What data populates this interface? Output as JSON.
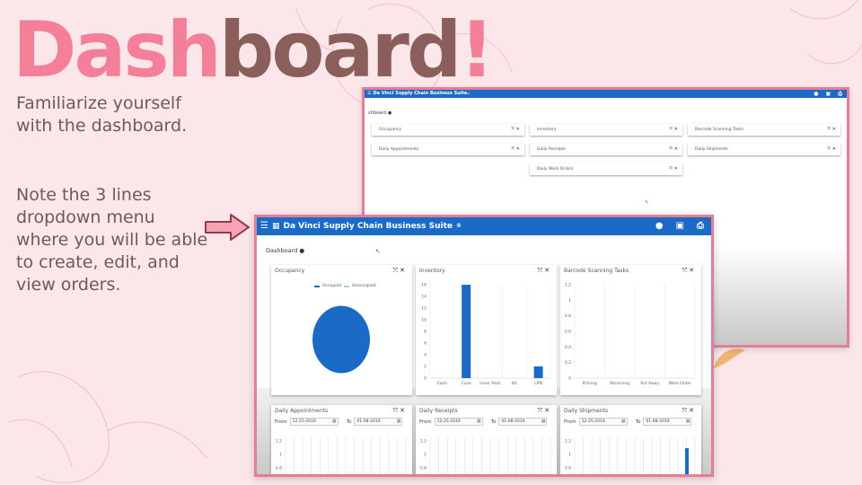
{
  "slide": {
    "title_part1": "Dash",
    "title_part2": "board",
    "title_bang": "!",
    "desc1": "Familiarize yourself with the dashboard.",
    "desc2": "Note the 3 lines dropdown menu where you will be able to create, edit, and view orders.",
    "colors": {
      "pink": "#f47f98",
      "brown": "#8a5e5a",
      "background": "#fbe7e9"
    }
  },
  "app": {
    "title": "Da Vinci Supply Chain Business Suite",
    "title_mark": "®",
    "menu_icon": "hamburger-icon",
    "header_icons": [
      "user-icon",
      "building-icon",
      "printer-icon"
    ],
    "breadcrumb": "Dashboard",
    "breadcrumb_back": "shboard",
    "accent": "#1a6bc5"
  },
  "back_window": {
    "widgets": [
      "Occupancy",
      "Inventory",
      "Barcode Scanning Tasks",
      "Daily Appointments",
      "Daily Receipts",
      "Daily Shipments",
      "Daily Work Orders"
    ]
  },
  "front_window": {
    "occupancy": {
      "title": "Occupancy",
      "legend": [
        "Occupied",
        "Unoccupied"
      ]
    },
    "inventory": {
      "title": "Inventory"
    },
    "barcode": {
      "title": "Barcode Scanning Tasks"
    },
    "daily_appointments": {
      "title": "Daily Appointments",
      "from_label": "From",
      "from": "12-25-2019",
      "to_label": "To",
      "to": "01-08-2019"
    },
    "daily_receipts": {
      "title": "Daily Receipts",
      "from_label": "From",
      "from": "12-25-2019",
      "to_label": "To",
      "to": "01-08-2019"
    },
    "daily_shipments": {
      "title": "Daily Shipments",
      "from_label": "From",
      "from": "12-25-2019",
      "to_label": "To",
      "to": "01-08-2019"
    }
  },
  "chart_data": [
    {
      "type": "pie",
      "categories": [
        "Occupied",
        "Unoccupied"
      ],
      "values": [
        100,
        0
      ],
      "colors": [
        "#1a6bc5",
        "#9ecbf0"
      ]
    },
    {
      "type": "bar",
      "categories": [
        "Each",
        "Case",
        "Inner Pack",
        "Kit",
        "LPN"
      ],
      "values": [
        0,
        16,
        0,
        0,
        2
      ],
      "yticks": [
        "0",
        "2",
        "4",
        "6",
        "8",
        "10",
        "12",
        "14",
        "16"
      ],
      "ylim": [
        0,
        16
      ]
    },
    {
      "type": "bar",
      "categories": [
        "Picking",
        "Receiving",
        "Put Away",
        "Work Order"
      ],
      "values": [
        0,
        0,
        0,
        0
      ],
      "yticks": [
        "0",
        "0.2",
        "0.4",
        "0.6",
        "0.8",
        "1",
        "1.2"
      ],
      "ylim": [
        0,
        1.2
      ]
    },
    {
      "type": "bar",
      "yticks": [
        "0.8",
        "1",
        "1.2"
      ]
    }
  ]
}
